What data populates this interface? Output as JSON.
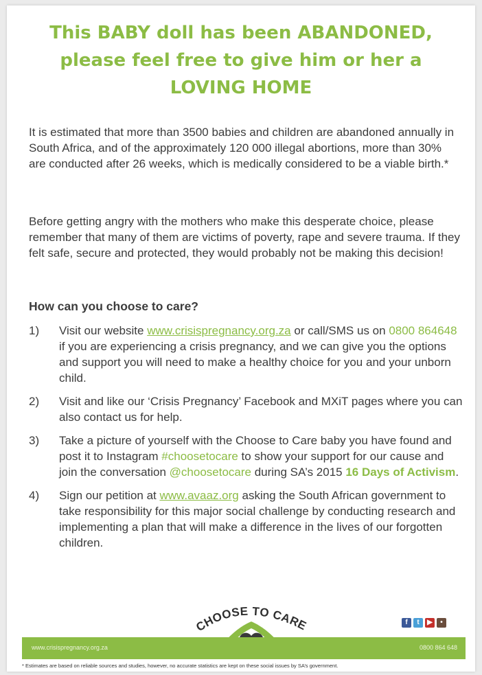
{
  "headline": {
    "line1": "This BABY doll has been ABANDONED,",
    "line2": "please feel free to give him or her a",
    "line3": "LOVING HOME"
  },
  "paragraphs": {
    "p1": "It is estimated that more than 3500 babies and children are abandoned annually in South Africa, and of the approximately 120 000 illegal abortions, more than 30% are conducted after 26 weeks, which is medically considered to be a viable birth.*",
    "p2": "Before getting angry with the mothers who make this desperate choice, please remember that many of them are victims of poverty, rape and severe trauma.  If they felt safe, secure and protected, they would probably not be making this decision!"
  },
  "subhead": "How can you choose to care?",
  "steps": {
    "s1": {
      "num": "1)",
      "t1": "Visit our website ",
      "link": "www.crisispregnancy.org.za",
      "t2": " or call/SMS us on ",
      "phone": "0800 864648",
      "t3": " if you are experiencing a crisis pregnancy, and we can give you the options and support you will need to make a healthy choice for you and your unborn child."
    },
    "s2": {
      "num": "2)",
      "text": "Visit and like our ‘Crisis Pregnancy’ Facebook and MXiT pages where you can also contact us for help."
    },
    "s3": {
      "num": "3)",
      "t1": "Take a picture of yourself with the Choose to Care baby you have found and post it to Instagram ",
      "hashtag": "#choosetocare",
      "t2": " to show your support for our cause and join the conversation ",
      "handle": "@choosetocare",
      "t3": " during SA’s 2015 ",
      "campaign": "16 Days of Activism",
      "t4": "."
    },
    "s4": {
      "num": "4)",
      "t1": "Sign our petition at ",
      "link": "www.avaaz.org",
      "t2": " asking the South African government to take responsibility for this major social challenge by conducting research and implementing a plan that will make a difference in the lives of our forgotten children."
    }
  },
  "logo": {
    "text": "CHOOSE TO CARE"
  },
  "social_icons": [
    "facebook-icon",
    "twitter-icon",
    "youtube-icon",
    "mxit-icon"
  ],
  "footer": {
    "url": "www.crisispregnancy.org.za",
    "phone": "0800 864 648",
    "footnote": "* Estimates are based on reliable sources and studies, however, no accurate statistics are kept on these social issues by SA’s government."
  },
  "colors": {
    "accent": "#8cbc45",
    "text": "#3c3c3c",
    "background": "#ffffff"
  }
}
